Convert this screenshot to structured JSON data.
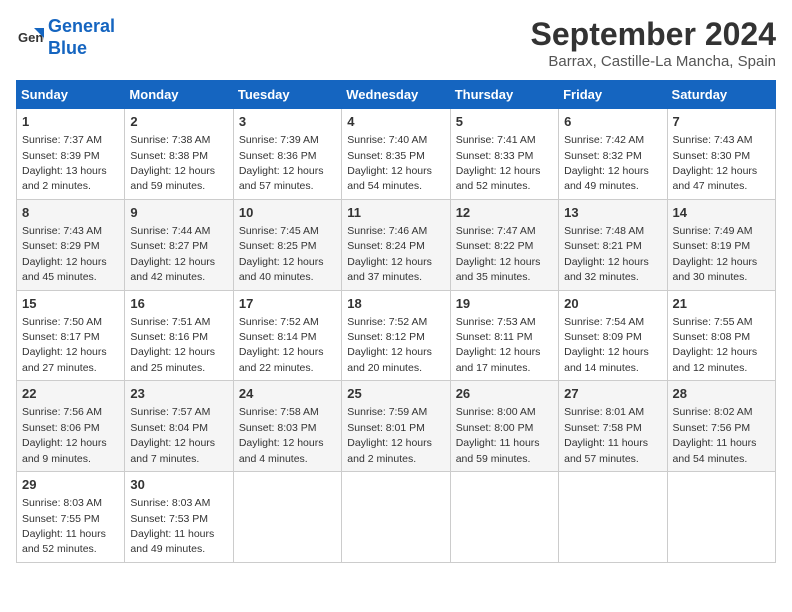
{
  "logo": {
    "line1": "General",
    "line2": "Blue"
  },
  "title": "September 2024",
  "location": "Barrax, Castille-La Mancha, Spain",
  "days_of_week": [
    "Sunday",
    "Monday",
    "Tuesday",
    "Wednesday",
    "Thursday",
    "Friday",
    "Saturday"
  ],
  "weeks": [
    [
      {
        "day": 1,
        "sunrise": "7:37 AM",
        "sunset": "8:39 PM",
        "daylight": "13 hours and 2 minutes."
      },
      {
        "day": 2,
        "sunrise": "7:38 AM",
        "sunset": "8:38 PM",
        "daylight": "12 hours and 59 minutes."
      },
      {
        "day": 3,
        "sunrise": "7:39 AM",
        "sunset": "8:36 PM",
        "daylight": "12 hours and 57 minutes."
      },
      {
        "day": 4,
        "sunrise": "7:40 AM",
        "sunset": "8:35 PM",
        "daylight": "12 hours and 54 minutes."
      },
      {
        "day": 5,
        "sunrise": "7:41 AM",
        "sunset": "8:33 PM",
        "daylight": "12 hours and 52 minutes."
      },
      {
        "day": 6,
        "sunrise": "7:42 AM",
        "sunset": "8:32 PM",
        "daylight": "12 hours and 49 minutes."
      },
      {
        "day": 7,
        "sunrise": "7:43 AM",
        "sunset": "8:30 PM",
        "daylight": "12 hours and 47 minutes."
      }
    ],
    [
      {
        "day": 8,
        "sunrise": "7:43 AM",
        "sunset": "8:29 PM",
        "daylight": "12 hours and 45 minutes."
      },
      {
        "day": 9,
        "sunrise": "7:44 AM",
        "sunset": "8:27 PM",
        "daylight": "12 hours and 42 minutes."
      },
      {
        "day": 10,
        "sunrise": "7:45 AM",
        "sunset": "8:25 PM",
        "daylight": "12 hours and 40 minutes."
      },
      {
        "day": 11,
        "sunrise": "7:46 AM",
        "sunset": "8:24 PM",
        "daylight": "12 hours and 37 minutes."
      },
      {
        "day": 12,
        "sunrise": "7:47 AM",
        "sunset": "8:22 PM",
        "daylight": "12 hours and 35 minutes."
      },
      {
        "day": 13,
        "sunrise": "7:48 AM",
        "sunset": "8:21 PM",
        "daylight": "12 hours and 32 minutes."
      },
      {
        "day": 14,
        "sunrise": "7:49 AM",
        "sunset": "8:19 PM",
        "daylight": "12 hours and 30 minutes."
      }
    ],
    [
      {
        "day": 15,
        "sunrise": "7:50 AM",
        "sunset": "8:17 PM",
        "daylight": "12 hours and 27 minutes."
      },
      {
        "day": 16,
        "sunrise": "7:51 AM",
        "sunset": "8:16 PM",
        "daylight": "12 hours and 25 minutes."
      },
      {
        "day": 17,
        "sunrise": "7:52 AM",
        "sunset": "8:14 PM",
        "daylight": "12 hours and 22 minutes."
      },
      {
        "day": 18,
        "sunrise": "7:52 AM",
        "sunset": "8:12 PM",
        "daylight": "12 hours and 20 minutes."
      },
      {
        "day": 19,
        "sunrise": "7:53 AM",
        "sunset": "8:11 PM",
        "daylight": "12 hours and 17 minutes."
      },
      {
        "day": 20,
        "sunrise": "7:54 AM",
        "sunset": "8:09 PM",
        "daylight": "12 hours and 14 minutes."
      },
      {
        "day": 21,
        "sunrise": "7:55 AM",
        "sunset": "8:08 PM",
        "daylight": "12 hours and 12 minutes."
      }
    ],
    [
      {
        "day": 22,
        "sunrise": "7:56 AM",
        "sunset": "8:06 PM",
        "daylight": "12 hours and 9 minutes."
      },
      {
        "day": 23,
        "sunrise": "7:57 AM",
        "sunset": "8:04 PM",
        "daylight": "12 hours and 7 minutes."
      },
      {
        "day": 24,
        "sunrise": "7:58 AM",
        "sunset": "8:03 PM",
        "daylight": "12 hours and 4 minutes."
      },
      {
        "day": 25,
        "sunrise": "7:59 AM",
        "sunset": "8:01 PM",
        "daylight": "12 hours and 2 minutes."
      },
      {
        "day": 26,
        "sunrise": "8:00 AM",
        "sunset": "8:00 PM",
        "daylight": "11 hours and 59 minutes."
      },
      {
        "day": 27,
        "sunrise": "8:01 AM",
        "sunset": "7:58 PM",
        "daylight": "11 hours and 57 minutes."
      },
      {
        "day": 28,
        "sunrise": "8:02 AM",
        "sunset": "7:56 PM",
        "daylight": "11 hours and 54 minutes."
      }
    ],
    [
      {
        "day": 29,
        "sunrise": "8:03 AM",
        "sunset": "7:55 PM",
        "daylight": "11 hours and 52 minutes."
      },
      {
        "day": 30,
        "sunrise": "8:03 AM",
        "sunset": "7:53 PM",
        "daylight": "11 hours and 49 minutes."
      },
      null,
      null,
      null,
      null,
      null
    ]
  ]
}
